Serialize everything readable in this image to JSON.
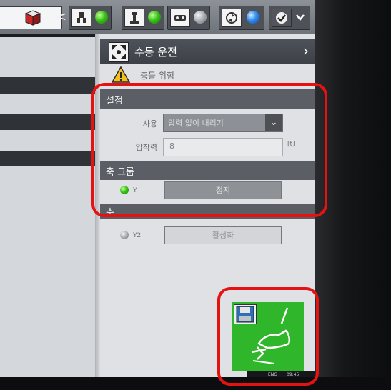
{
  "toolbar": {
    "back_glyph": "<",
    "groups": [
      {
        "icon": "gripper-icon",
        "status": "green"
      },
      {
        "icon": "robot-arm-icon",
        "status": "green"
      },
      {
        "icon": "conveyor-icon",
        "status": "grey"
      },
      {
        "icon": "recycle-icon",
        "status": "blue"
      },
      {
        "icon": "checkmark-icon",
        "status": "dropdown"
      }
    ],
    "led_colors": {
      "green": "#39c417",
      "grey": "#a8abb0",
      "blue": "#2f8cf0"
    }
  },
  "panel": {
    "title": "수동 운전",
    "warning": "충돌 위험",
    "settings": {
      "header": "설정",
      "use_label": "사용",
      "use_value": "압력 없이 내리기",
      "pressure_label": "압착력",
      "pressure_value": "8",
      "pressure_unit": "[t]"
    },
    "axis_group": {
      "header": "축 그룹",
      "axis_name": "Y",
      "axis_status": "green",
      "button_label": "정지"
    },
    "axis": {
      "header": "축",
      "axis_name": "Y2",
      "axis_status": "grey",
      "button_label": "활성화"
    }
  },
  "action_button": {
    "icon": "foot-pedal-icon",
    "save_icon": "save-icon",
    "color": "#2fb62b"
  },
  "taskbar": {
    "language": "ENG",
    "time": "09:45"
  },
  "annotation_color": "#e51212"
}
